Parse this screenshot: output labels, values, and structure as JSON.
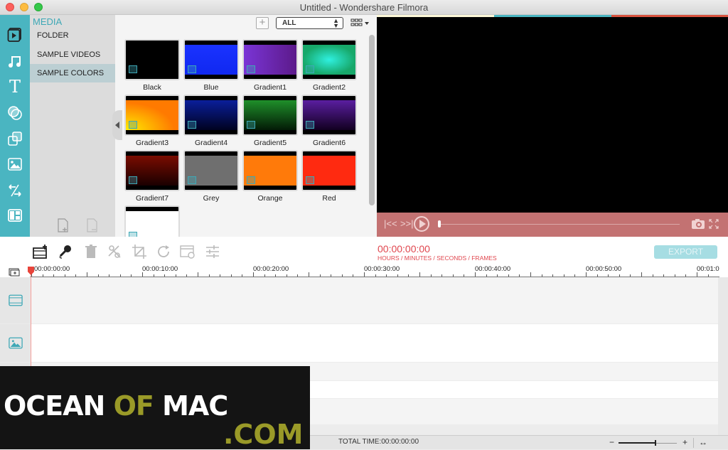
{
  "window": {
    "title": "Untitled - Wondershare Filmora"
  },
  "left_toolbar": {
    "items": [
      {
        "name": "media-icon",
        "label": "Media"
      },
      {
        "name": "music-icon",
        "label": "Music"
      },
      {
        "name": "text-icon",
        "label": "Text"
      },
      {
        "name": "filters-icon",
        "label": "Filters"
      },
      {
        "name": "overlays-icon",
        "label": "Overlays"
      },
      {
        "name": "elements-icon",
        "label": "Elements"
      },
      {
        "name": "transitions-icon",
        "label": "Transitions"
      },
      {
        "name": "split-screen-icon",
        "label": "Split Screen"
      }
    ]
  },
  "media_panel": {
    "title": "MEDIA",
    "items": [
      {
        "label": "FOLDER",
        "selected": false
      },
      {
        "label": "SAMPLE VIDEOS",
        "selected": false
      },
      {
        "label": "SAMPLE COLORS",
        "selected": true
      }
    ]
  },
  "library": {
    "filter_value": "ALL",
    "thumbnails": [
      {
        "label": "Black",
        "fill": "#000000"
      },
      {
        "label": "Blue",
        "fill": "linear-gradient(#1a33ff,#1028f0)"
      },
      {
        "label": "Gradient1",
        "fill": "linear-gradient(90deg,#7a35d6,#5c1a8a)"
      },
      {
        "label": "Gradient2",
        "fill": "radial-gradient(ellipse at 50% 50%,#2ff0e0,#17a86a 70%)"
      },
      {
        "label": "Gradient3",
        "fill": "radial-gradient(ellipse at 0% 100%,#ffee00,#ff7a00 65%)"
      },
      {
        "label": "Gradient4",
        "fill": "linear-gradient(#0a1e9a,#000220)"
      },
      {
        "label": "Gradient5",
        "fill": "linear-gradient(#1f8f2a,#031a06)"
      },
      {
        "label": "Gradient6",
        "fill": "linear-gradient(#5a1ea0,#120020)"
      },
      {
        "label": "Gradient7",
        "fill": "linear-gradient(#7a0c00,#1a0000)"
      },
      {
        "label": "Grey",
        "fill": "#6f6f6f"
      },
      {
        "label": "Orange",
        "fill": "#ff7a0a"
      },
      {
        "label": "Red",
        "fill": "#ff2a10"
      },
      {
        "label": "",
        "fill": "#ffffff"
      }
    ]
  },
  "preview": {
    "strip_colors": [
      "#fdf8d8",
      "#4ab5c1",
      "#d9533f"
    ],
    "progress": 0
  },
  "editor_toolbar": {
    "timecode": "00:00:00:00",
    "timecode_label": "HOURS / MINUTES / SECONDS / FRAMES",
    "export_label": "EXPORT"
  },
  "timeline": {
    "ruler_labels": [
      "00:00:00:00",
      "00:00:10:00",
      "00:00:20:00",
      "00:00:30:00",
      "00:00:40:00",
      "00:00:50:00",
      "00:01:0"
    ],
    "tracks": [
      "video",
      "image",
      "text",
      "music"
    ]
  },
  "status_bar": {
    "total_time": "TOTAL TIME:00:00:00:00",
    "zoom_level": 0.62
  },
  "watermark": {
    "part1": "OCEAN",
    "part2": "OF",
    "part3": "MAC",
    "part4": ".COM"
  }
}
